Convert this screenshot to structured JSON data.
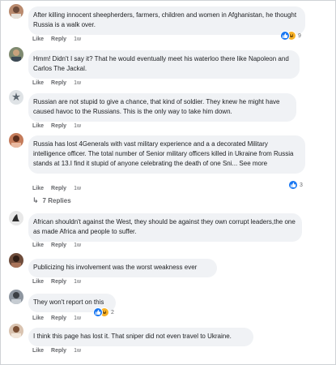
{
  "action_labels": {
    "like": "Like",
    "reply": "Reply"
  },
  "comments": [
    {
      "text": "After killing innocent sheepherders, farmers, children and women in Afghanistan, he thought Russia is a walk over.",
      "time": "1w",
      "reactions": {
        "icons": [
          "like-icon",
          "haha-icon"
        ],
        "count": "9"
      }
    },
    {
      "text": "Hmm! Didn't I say it? That he would eventually meet his waterloo there like Napoleon and Carlos The Jackal.",
      "time": "1w"
    },
    {
      "text": "Russian are not stupid to give a chance, that kind of soldier. They knew he might have caused havoc to the Russians. This is the only way to take him down.",
      "time": "1w"
    },
    {
      "text": "Russia has lost 4Generals with vast military experience and a a decorated Military intelligence officer. The total number of Senior military officers killed in Ukraine from Russia stands at 13.I find it stupid of anyone celebrating the death of one Sni...",
      "see_more": "See more",
      "time": "1w",
      "reactions": {
        "icons": [
          "like-icon"
        ],
        "count": "3"
      },
      "replies_label": "7 Replies"
    },
    {
      "text": "African shouldn't against the West, they should be against they own corrupt leaders,the one as made Africa and people to suffer.",
      "time": "1w"
    },
    {
      "text": "Publicizing his involvement was the worst weakness ever",
      "time": "1w"
    },
    {
      "text": "They won't report on this",
      "time": "1w",
      "reactions": {
        "icons": [
          "like-icon",
          "haha-icon"
        ],
        "count": "2"
      }
    },
    {
      "text": "I think this page has lost it. That sniper did not even travel to Ukraine.",
      "time": "1w"
    }
  ],
  "colors": {
    "bubble": "#f0f2f5",
    "meta_text": "#65676b",
    "like_blue": "#1877f2",
    "haha_yellow": "#f7b125"
  }
}
